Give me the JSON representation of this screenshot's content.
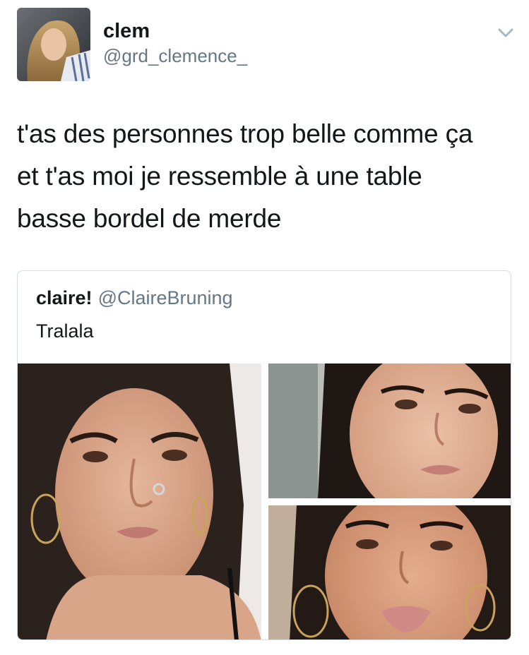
{
  "tweet": {
    "author_name": "clem",
    "author_handle": "@grd_clemence_",
    "menu_icon": "chevron-down-icon",
    "text": "t'as des personnes trop belle comme ça\net t'as moi je ressemble à une table\nbasse bordel de merde"
  },
  "quoted_tweet": {
    "author_name": "claire!",
    "author_handle": "@ClaireBruning",
    "text": "Tralala",
    "photos": [
      {
        "description": "selfie"
      },
      {
        "description": "selfie"
      },
      {
        "description": "selfie"
      }
    ]
  },
  "colors": {
    "text_primary": "#14171a",
    "text_secondary": "#657786",
    "border": "#d6dde3"
  }
}
